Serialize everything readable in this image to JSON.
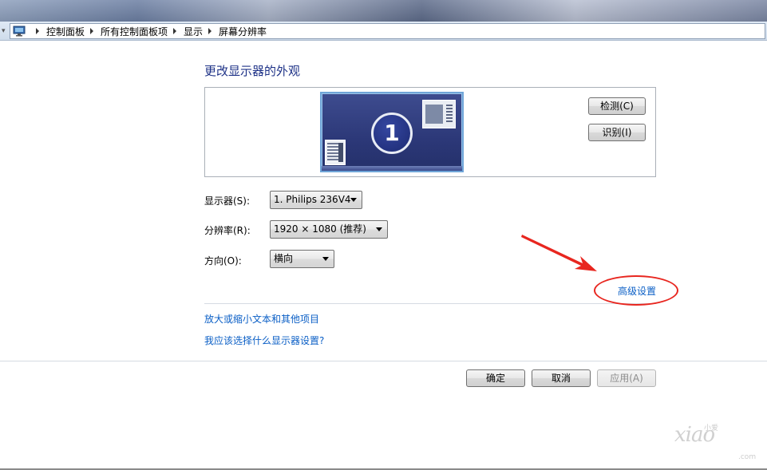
{
  "breadcrumb": {
    "items": [
      "控制面板",
      "所有控制面板项",
      "显示",
      "屏幕分辨率"
    ]
  },
  "page": {
    "title": "更改显示器的外观"
  },
  "preview": {
    "monitor_number": "1",
    "detect_label": "检测(C)",
    "identify_label": "识别(I)"
  },
  "form": {
    "display_label": "显示器(S):",
    "display_value": "1. Philips 236V4",
    "resolution_label": "分辨率(R):",
    "resolution_value": "1920 × 1080 (推荐)",
    "orientation_label": "方向(O):",
    "orientation_value": "横向"
  },
  "links": {
    "advanced": "高级设置",
    "text_size": "放大或缩小文本和其他项目",
    "which_settings": "我应该选择什么显示器设置?"
  },
  "footer": {
    "ok_label": "确定",
    "cancel_label": "取消",
    "apply_label": "应用(A)"
  },
  "watermark": {
    "brand": "xiao",
    "small": "小爱",
    "com": ".com"
  },
  "colors": {
    "link": "#0b5fc6",
    "title": "#1e3287",
    "annotation": "#e8261f"
  }
}
